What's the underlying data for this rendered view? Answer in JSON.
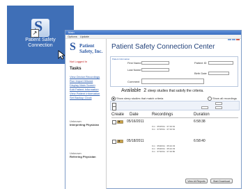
{
  "desktop": {
    "icon_name": "patient-safety-app-icon",
    "label_line1": "Patient Safety",
    "label_line2": "Connection"
  },
  "window": {
    "title": "Main",
    "menu": [
      "Options",
      "Update"
    ]
  },
  "sidebar": {
    "logo_line1": "Patient",
    "logo_line2": "Safety, Inc.",
    "not_logged_in": "Not Logged In",
    "tasks_heading": "Tasks",
    "tasks": [
      "View Device Recordings",
      "Run Import Wizard",
      "Display Main Screen",
      "Edit Patient Information",
      "View Patient Information",
      "Set Backup Clock"
    ],
    "followup1_label": "Unknown",
    "followup1_role": "Interpreting Physician",
    "followup2_label": "Unknown",
    "followup2_role": "Referring Physician"
  },
  "main": {
    "title": "Patient Safety Connection Center",
    "box_caption": "Patient Information",
    "first_name_label": "First Name",
    "patient_id_label": "Patient ID",
    "last_name_label": "Last Name",
    "birth_date_label": "Birth Date",
    "comment_label": "Comment",
    "available_label": "Available",
    "available_count": "2",
    "available_rest": "sleep studies that satisfy the criteria.",
    "show_matching_label": "Show sleep studies that match criteria",
    "show_all_label": "Show all recordings",
    "columns": [
      "Create",
      "Date",
      "Recordings",
      "Duration"
    ],
    "rows": [
      {
        "date": "05/16/2011",
        "duration": "6:58:38",
        "details": "0 m   05/15/11   07:19 62\n0 m   07/15/11   07:19 62"
      },
      {
        "date": "05/18/2011",
        "duration": "6:58:40",
        "details": "0 m   05/20/11   05:24 03\n0 m   05/20/11   05:24 03\n0 m   07/10/11   07:19 80"
      }
    ],
    "view_all_reports": "View All Reports",
    "start_download": "Start Download"
  }
}
